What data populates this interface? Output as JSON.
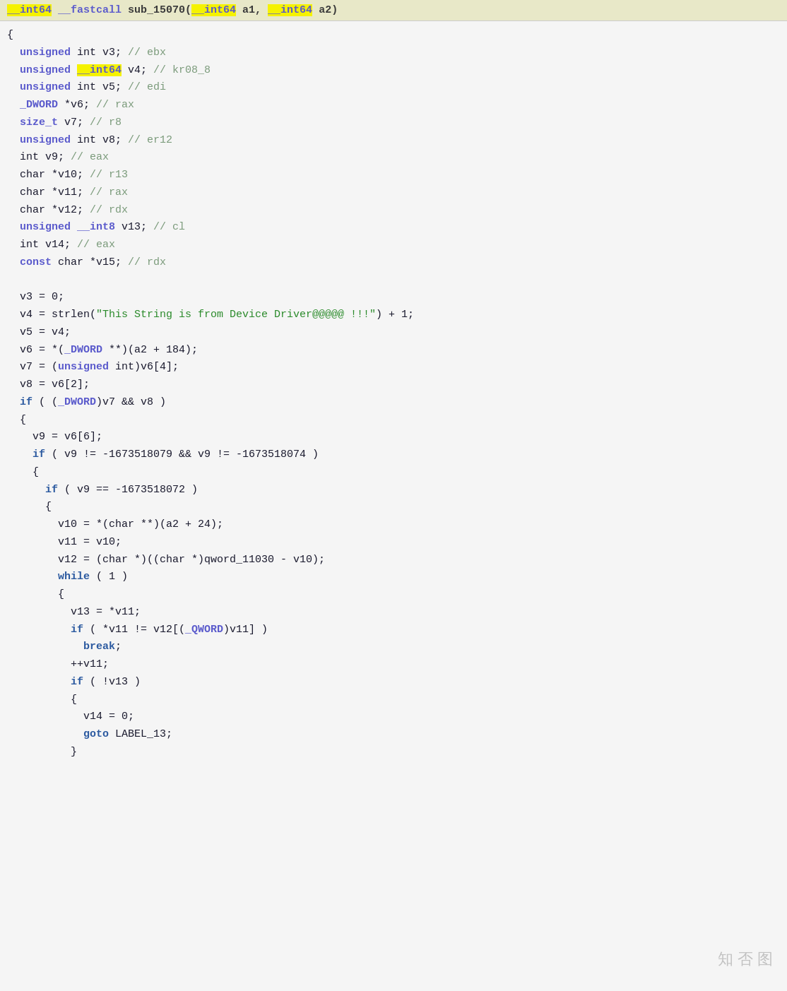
{
  "header": {
    "text": "__int64 __fastcall sub_15070(__int64 a1, __int64 a2)"
  },
  "code": {
    "lines": [
      {
        "id": 1,
        "content": "{"
      },
      {
        "id": 2,
        "content": "  unsigned int v3; // ebx"
      },
      {
        "id": 3,
        "content": "  unsigned __int64 v4; // kr08_8"
      },
      {
        "id": 4,
        "content": "  unsigned int v5; // edi"
      },
      {
        "id": 5,
        "content": "  _DWORD *v6; // rax"
      },
      {
        "id": 6,
        "content": "  size_t v7; // r8"
      },
      {
        "id": 7,
        "content": "  unsigned int v8; // er12"
      },
      {
        "id": 8,
        "content": "  int v9; // eax"
      },
      {
        "id": 9,
        "content": "  char *v10; // r13"
      },
      {
        "id": 10,
        "content": "  char *v11; // rax"
      },
      {
        "id": 11,
        "content": "  char *v12; // rdx"
      },
      {
        "id": 12,
        "content": "  unsigned __int8 v13; // cl"
      },
      {
        "id": 13,
        "content": "  int v14; // eax"
      },
      {
        "id": 14,
        "content": "  const char *v15; // rdx"
      },
      {
        "id": 15,
        "content": ""
      },
      {
        "id": 16,
        "content": "  v3 = 0;"
      },
      {
        "id": 17,
        "content": "  v4 = strlen(\"This String is from Device Driver@@@@@ !!!\") + 1;"
      },
      {
        "id": 18,
        "content": "  v5 = v4;"
      },
      {
        "id": 19,
        "content": "  v6 = *(_DWORD **)(a2 + 184);"
      },
      {
        "id": 20,
        "content": "  v7 = (unsigned int)v6[4];"
      },
      {
        "id": 21,
        "content": "  v8 = v6[2];"
      },
      {
        "id": 22,
        "content": "  if ( (_DWORD)v7 && v8 )"
      },
      {
        "id": 23,
        "content": "  {"
      },
      {
        "id": 24,
        "content": "    v9 = v6[6];"
      },
      {
        "id": 25,
        "content": "    if ( v9 != -1673518079 && v9 != -1673518074 )"
      },
      {
        "id": 26,
        "content": "    {"
      },
      {
        "id": 27,
        "content": "      if ( v9 == -1673518072 )"
      },
      {
        "id": 28,
        "content": "      {"
      },
      {
        "id": 29,
        "content": "        v10 = *(char **)(a2 + 24);"
      },
      {
        "id": 30,
        "content": "        v11 = v10;"
      },
      {
        "id": 31,
        "content": "        v12 = (char *)((char *)qword_11030 - v10);"
      },
      {
        "id": 32,
        "content": "        while ( 1 )"
      },
      {
        "id": 33,
        "content": "        {"
      },
      {
        "id": 34,
        "content": "          v13 = *v11;"
      },
      {
        "id": 35,
        "content": "          if ( *v11 != v12[(_QWORD)v11] )"
      },
      {
        "id": 36,
        "content": "            break;"
      },
      {
        "id": 37,
        "content": "          ++v11;"
      },
      {
        "id": 38,
        "content": "          if ( !v13 )"
      },
      {
        "id": 39,
        "content": "          {"
      },
      {
        "id": 40,
        "content": "            v14 = 0;"
      },
      {
        "id": 41,
        "content": "            goto LABEL_13;"
      },
      {
        "id": 42,
        "content": "          }"
      },
      {
        "id": 43,
        "content": ""
      }
    ]
  },
  "watermark": "知 否 图"
}
